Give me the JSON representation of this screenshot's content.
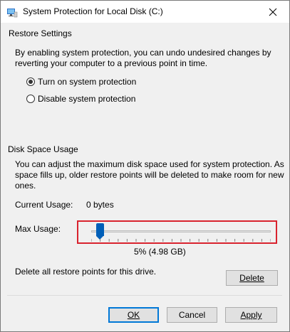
{
  "window": {
    "title": "System Protection for Local Disk (C:)",
    "close_icon": "close-icon"
  },
  "restore_settings": {
    "group_label": "Restore Settings",
    "description_line1": "By enabling system protection, you can undo undesired changes by",
    "description_line2": "reverting your computer to a previous point in time.",
    "options": [
      {
        "label": "Turn on system protection",
        "selected": true
      },
      {
        "label": "Disable system protection",
        "selected": false
      }
    ]
  },
  "disk_space": {
    "group_label": "Disk Space Usage",
    "description_line1": "You can adjust the maximum disk space used for system protection. As",
    "description_line2": "space fills up, older restore points will be deleted to make room for new",
    "description_line3": "ones.",
    "current_usage_label": "Current Usage:",
    "current_usage_value": "0 bytes",
    "max_usage_label": "Max Usage:",
    "max_usage_percent": 5,
    "max_usage_readout": "5% (4.98 GB)",
    "delete_text": "Delete all restore points for this drive.",
    "delete_button": "Delete"
  },
  "buttons": {
    "ok": "OK",
    "cancel": "Cancel",
    "apply": "Apply"
  },
  "colors": {
    "accent": "#0078d7",
    "slider_thumb": "#005fb8",
    "highlight_border": "#d9232e"
  }
}
